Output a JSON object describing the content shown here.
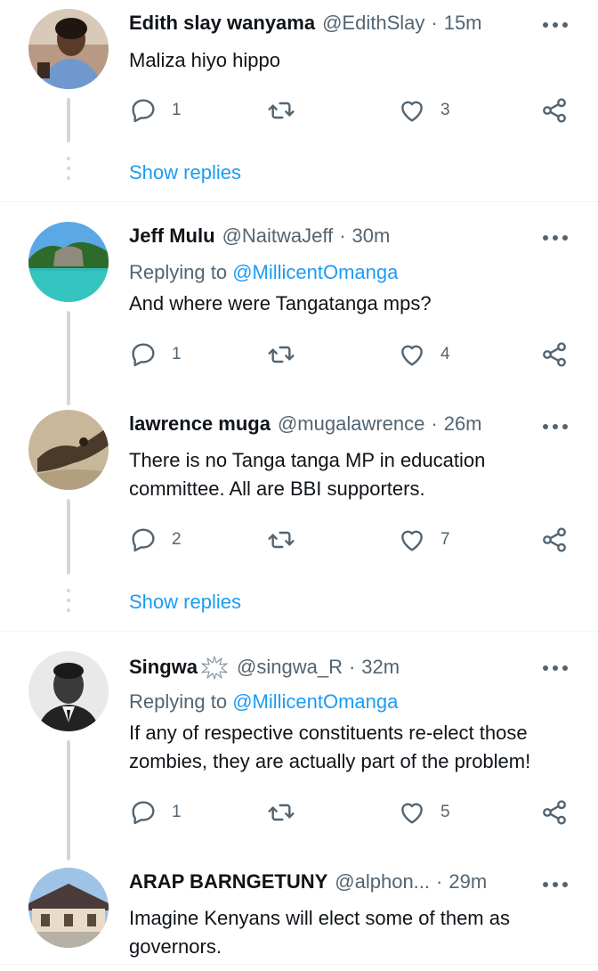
{
  "tweets": [
    {
      "name": "Edith slay wanyama",
      "handle": "@EdithSlay",
      "separator": "·",
      "time": "15m",
      "text": "Maliza hiyo hippo",
      "replies": "1",
      "retweets": "",
      "likes": "3",
      "show_replies": "Show replies"
    },
    {
      "name": "Jeff Mulu",
      "handle": "@NaitwaJeff",
      "separator": "·",
      "time": "30m",
      "replying_prefix": "Replying to",
      "replying_to": "@MillicentOmanga",
      "text": "And where were Tangatanga mps?",
      "replies": "1",
      "retweets": "",
      "likes": "4"
    },
    {
      "name": "lawrence muga",
      "handle": "@mugalawrence",
      "separator": "·",
      "time": "26m",
      "text": "There is no Tanga tanga MP in education committee. All are BBI supporters.",
      "replies": "2",
      "retweets": "",
      "likes": "7",
      "show_replies": "Show replies"
    },
    {
      "name": "Singwa",
      "handle": "@singwa_R",
      "separator": "·",
      "time": "32m",
      "replying_prefix": "Replying to",
      "replying_to": "@MillicentOmanga",
      "text": "If any of respective constituents re-elect those zombies, they are actually part of the problem!",
      "replies": "1",
      "retweets": "",
      "likes": "5"
    },
    {
      "name": "ARAP BARNGETUNY",
      "handle": "@alphon...",
      "separator": "·",
      "time": "29m",
      "text": "Imagine Kenyans will elect some of them as governors."
    }
  ],
  "icons": {
    "reply": "reply-icon",
    "retweet": "retweet-icon",
    "like": "heart-icon",
    "share": "share-icon",
    "more": "more-icon",
    "verified": "verified-badge-icon"
  },
  "colors": {
    "text": "#0f1419",
    "secondary": "#536471",
    "accent": "#1d9bf0",
    "thread_line": "#cfd9de"
  }
}
